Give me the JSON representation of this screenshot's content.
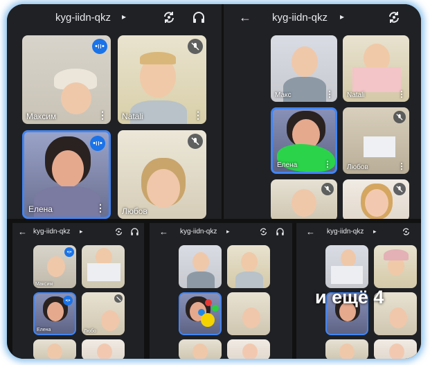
{
  "meeting_code": "kyg-iidn-qkz",
  "chevron": "▸",
  "back_arrow": "←",
  "more_dots": "⋮",
  "overlay_more": "и ещё 4",
  "participants": {
    "maksim": "Максим",
    "maks": "Макс",
    "natali": "Natali",
    "elena": "Елена",
    "lyubov": "Любов",
    "lyubov_short": "Любо"
  },
  "icons": [
    "back-arrow-icon",
    "switch-camera-icon",
    "headphones-icon",
    "mic-off-icon",
    "speaking-icon"
  ],
  "colors": {
    "panel_bg": "#202124",
    "active_border": "#4285f4",
    "accent": "#1a73e8",
    "glow": "#2c8cdc"
  }
}
